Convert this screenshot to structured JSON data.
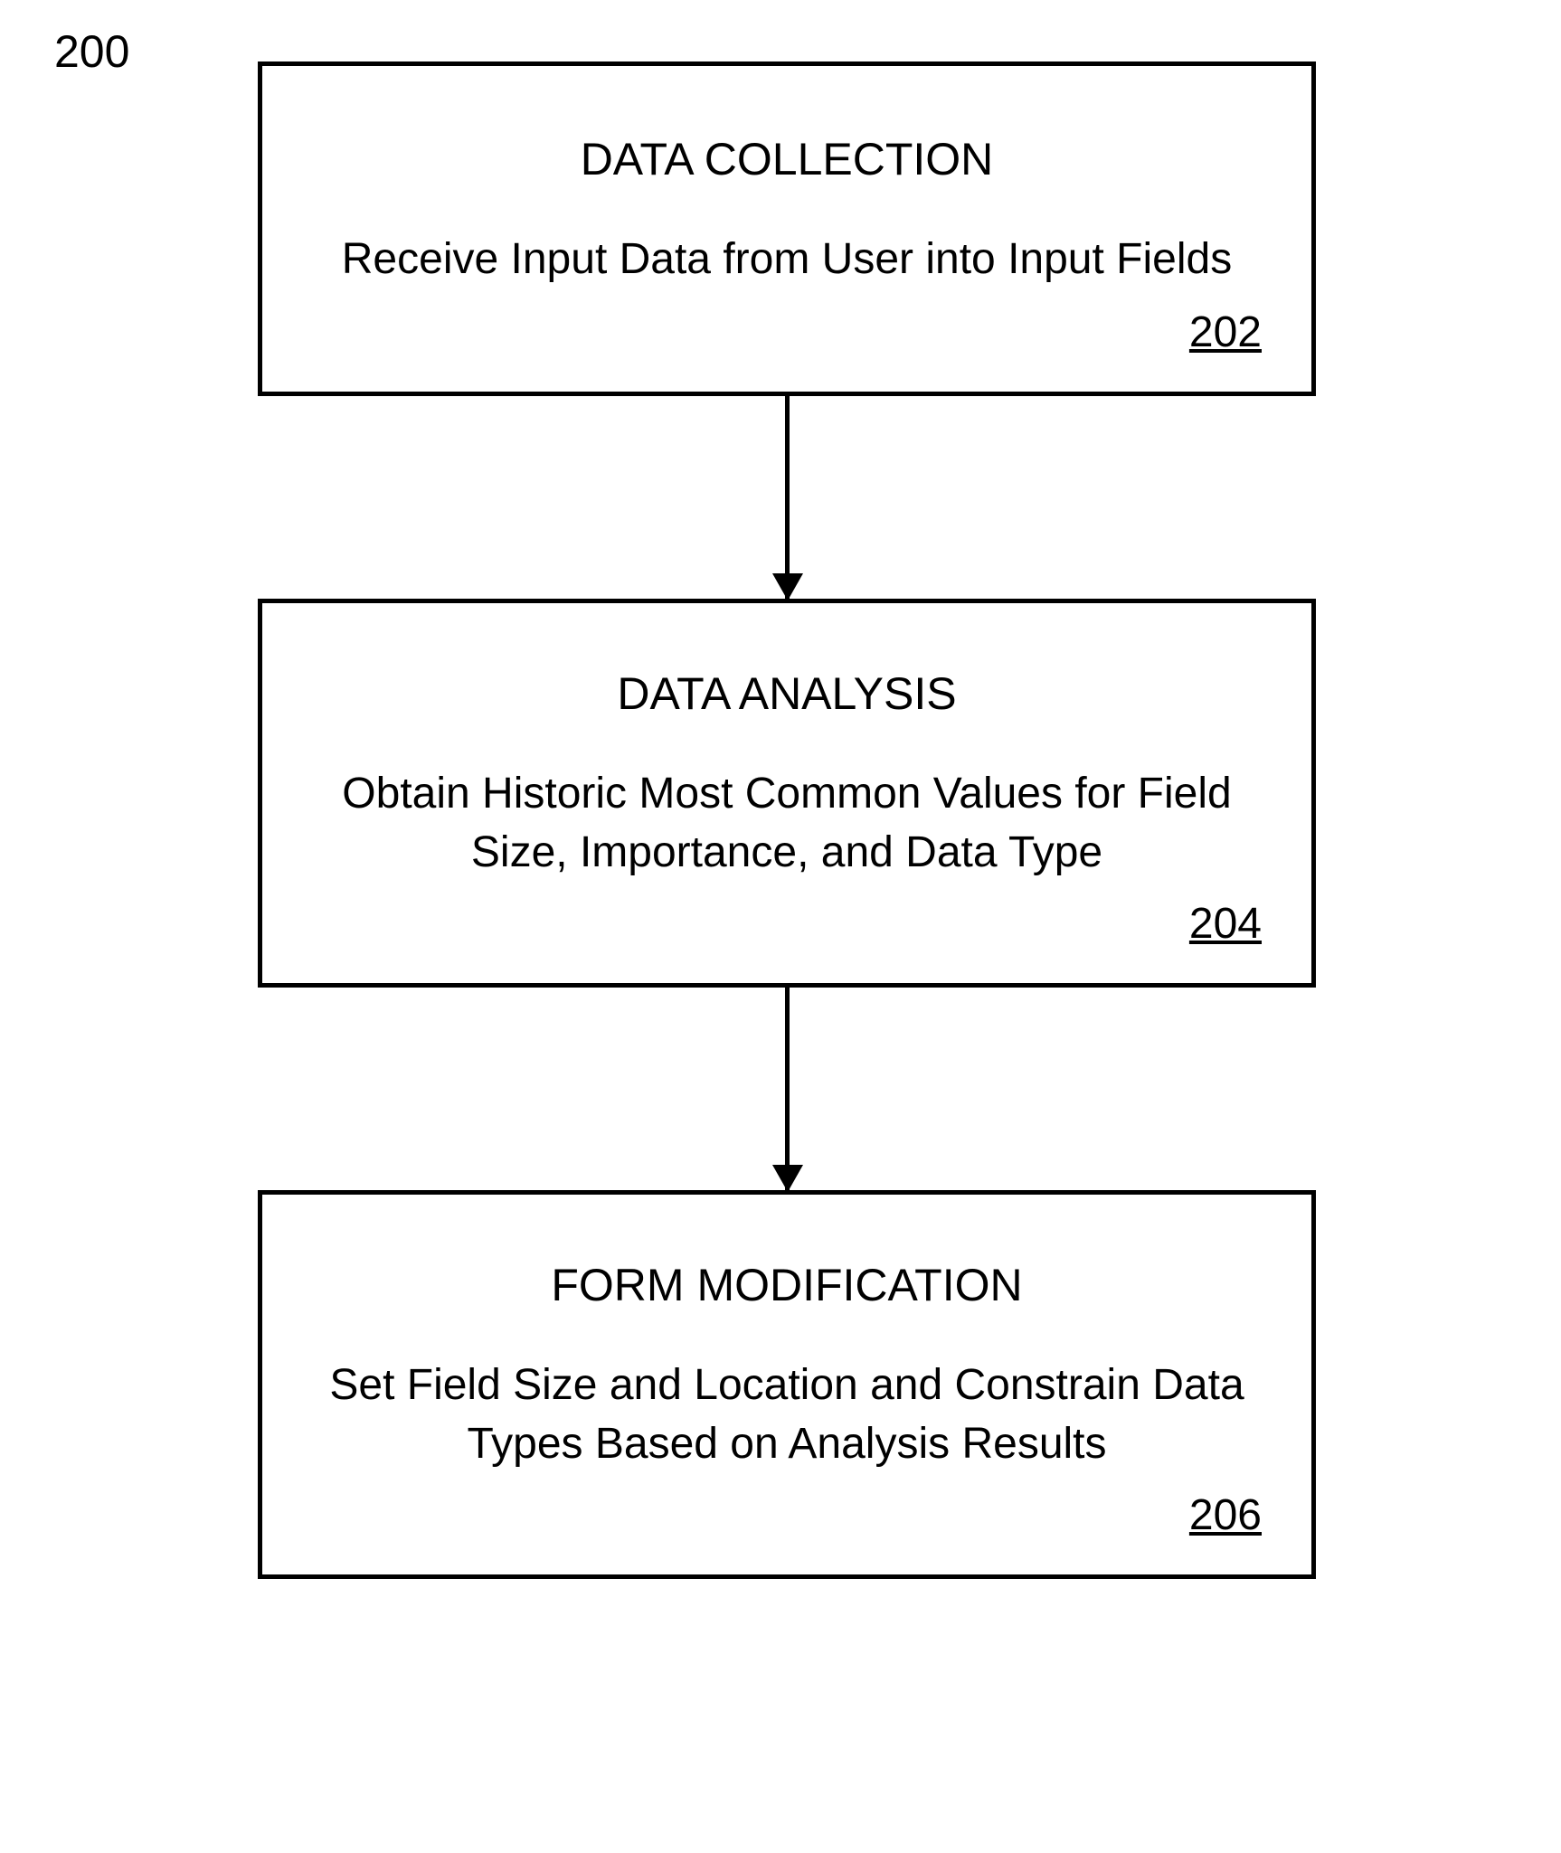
{
  "figure_label": "200",
  "steps": [
    {
      "title": "DATA COLLECTION",
      "desc": "Receive Input Data from User into Input Fields",
      "ref": "202"
    },
    {
      "title": "DATA ANALYSIS",
      "desc": "Obtain Historic Most Common Values for Field Size, Importance, and Data Type",
      "ref": "204"
    },
    {
      "title": "FORM MODIFICATION",
      "desc": "Set Field Size and Location and Constrain Data Types Based on Analysis Results",
      "ref": "206"
    }
  ]
}
